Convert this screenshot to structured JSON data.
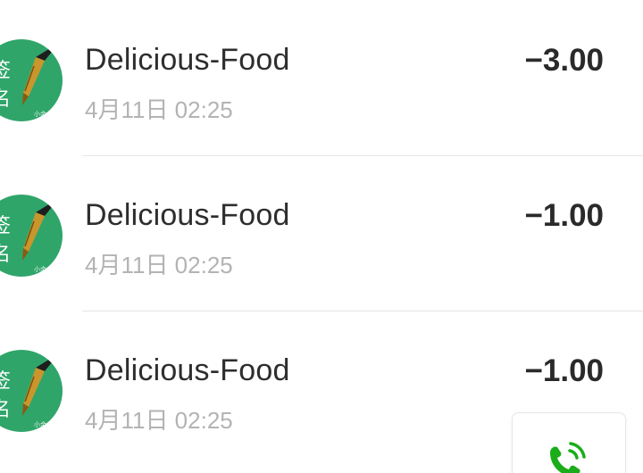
{
  "transactions": [
    {
      "merchant": "Delicious-Food",
      "time": "4月11日 02:25",
      "amount": "−3.00"
    },
    {
      "merchant": "Delicious-Food",
      "time": "4月11日 02:25",
      "amount": "−1.00"
    },
    {
      "merchant": "Delicious-Food",
      "time": "4月11日 02:25",
      "amount": "−1.00"
    }
  ],
  "avatar": {
    "glyph_top": "签",
    "glyph_bottom": "名",
    "icon": "fountain-pen-icon"
  },
  "floating_button": {
    "icon": "phone-call-icon",
    "color": "#1aad19"
  },
  "colors": {
    "avatar_green": "#2fa56a",
    "text_primary": "#2e2e2e",
    "text_secondary": "#b3b3b3"
  }
}
